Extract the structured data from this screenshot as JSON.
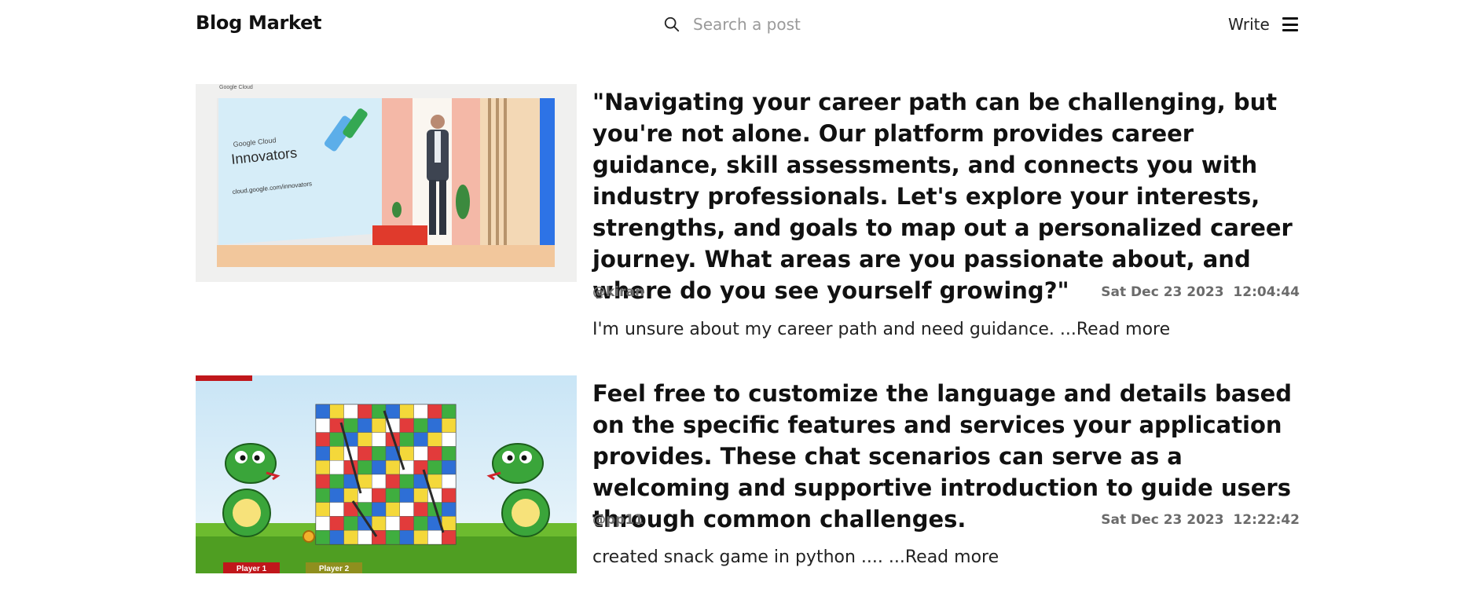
{
  "header": {
    "brand": "Blog Market",
    "search_placeholder": "Search a post",
    "write_label": "Write",
    "icons": [
      "search-icon",
      "menu-icon"
    ]
  },
  "posts": [
    {
      "title": "\"Navigating your career path can be challenging, but you're not alone. Our platform provides career guidance, skill assessments, and connects you with industry professionals. Let's explore your interests, strengths, and goals to map out a personalized career journey. What areas are you passionate about, and where do you see yourself growing?\"",
      "author": "@kiran",
      "date": "Sat Dec 23 2023  12:04:44",
      "excerpt": "I'm unsure about my career path and need guidance. ...",
      "read_more": "Read more",
      "image": {
        "brand_text": "Google Cloud",
        "slide_brand": "Google Cloud",
        "slide_title": "Innovators",
        "slide_url": "cloud.google.com/innovators"
      }
    },
    {
      "title": "Feel free to customize the language and details based on the specific features and services your application provides. These chat scenarios can serve as a welcoming and supportive introduction to guide users through common challenges.",
      "author": "@pp11",
      "date": "Sat Dec 23 2023  12:22:42",
      "excerpt": "created snack game in python .... ...",
      "read_more": "Read more",
      "image": {
        "player1": "Player 1",
        "player2": "Player 2"
      }
    }
  ],
  "colors": {
    "text": "#111111",
    "muted": "#6b6b6b",
    "placeholder": "#9a9a9a"
  }
}
